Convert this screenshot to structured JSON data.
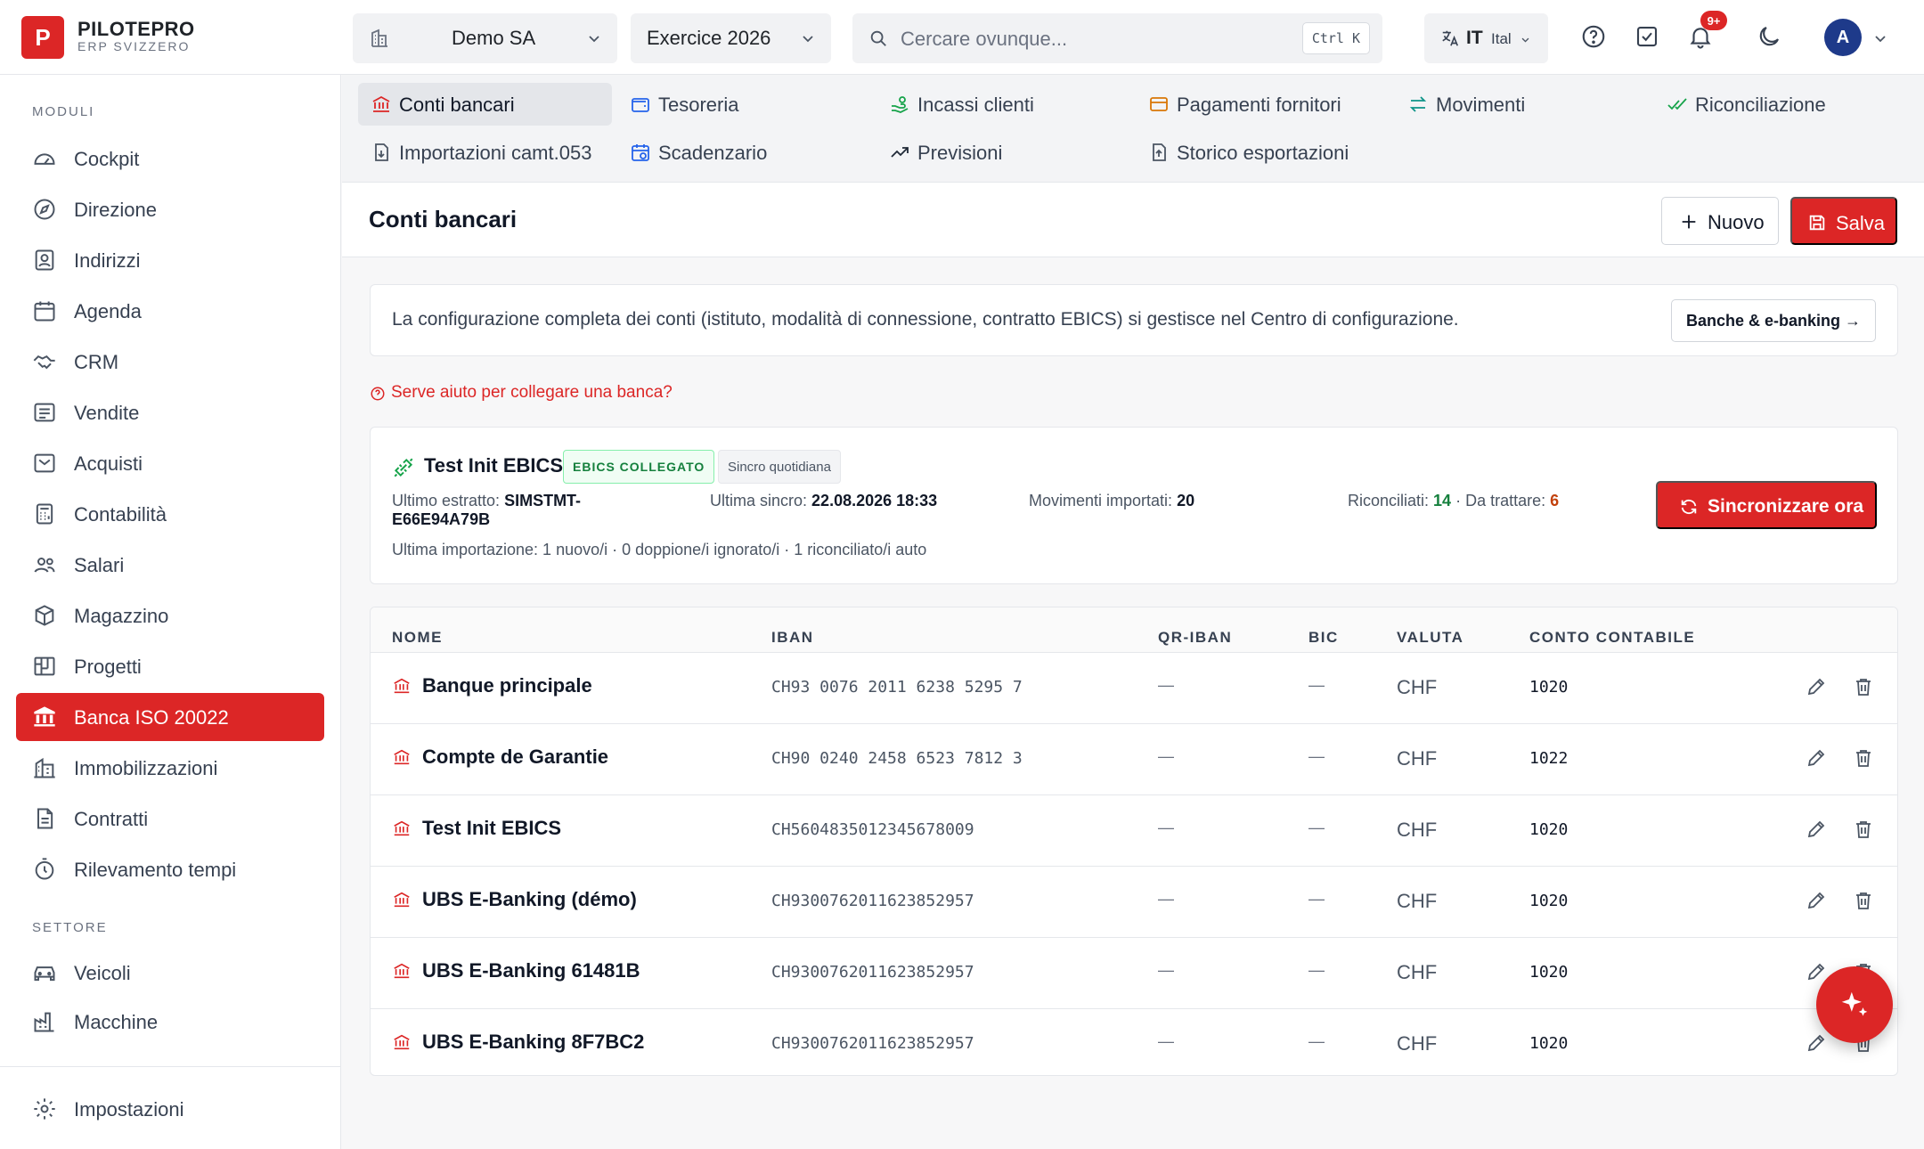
{
  "app": {
    "logo_letter": "P",
    "brand": "PILOTEPRO",
    "subtitle": "ERP SVIZZERO",
    "company": "Demo SA",
    "fiscal_year": "Exercice 2026",
    "search_placeholder": "Cercare ovunque...",
    "search_shortcut": "Ctrl K",
    "lang_code": "IT",
    "lang_name": "Ital",
    "notifications_badge": "9+",
    "avatar_letter": "A",
    "accent_color": "#dc2626"
  },
  "sidebar": {
    "section_modules": "MODULI",
    "modules": [
      {
        "label": "Cockpit",
        "icon": "gauge-icon"
      },
      {
        "label": "Direzione",
        "icon": "compass-icon"
      },
      {
        "label": "Indirizzi",
        "icon": "contact-card-icon"
      },
      {
        "label": "Agenda",
        "icon": "calendar-icon"
      },
      {
        "label": "CRM",
        "icon": "handshake-icon"
      },
      {
        "label": "Vendite",
        "icon": "receipt-icon"
      },
      {
        "label": "Acquisti",
        "icon": "inbox-icon"
      },
      {
        "label": "Contabilità",
        "icon": "calculator-icon"
      },
      {
        "label": "Salari",
        "icon": "users-icon"
      },
      {
        "label": "Magazzino",
        "icon": "package-icon"
      },
      {
        "label": "Progetti",
        "icon": "kanban-icon"
      },
      {
        "label": "Banca ISO 20022",
        "icon": "bank-icon",
        "active": true
      },
      {
        "label": "Immobilizzazioni",
        "icon": "building-icon"
      },
      {
        "label": "Contratti",
        "icon": "document-icon"
      },
      {
        "label": "Rilevamento tempi",
        "icon": "timer-icon"
      }
    ],
    "section_sector": "SETTORE",
    "sector": [
      {
        "label": "Veicoli",
        "icon": "car-icon"
      },
      {
        "label": "Macchine",
        "icon": "factory-icon"
      }
    ],
    "settings": "Impostazioni"
  },
  "subnav": {
    "tabs": [
      {
        "label": "Conti bancari",
        "icon": "bank-icon",
        "active": true
      },
      {
        "label": "Tesoreria",
        "icon": "wallet-icon"
      },
      {
        "label": "Incassi clienti",
        "icon": "hand-coins-icon"
      },
      {
        "label": "Pagamenti fornitori",
        "icon": "credit-card-icon"
      },
      {
        "label": "Movimenti",
        "icon": "arrows-swap-icon"
      },
      {
        "label": "Riconciliazione",
        "icon": "double-check-icon"
      },
      {
        "label": "Importazioni camt.053",
        "icon": "file-import-icon"
      },
      {
        "label": "Scadenzario",
        "icon": "calendar-clock-icon"
      },
      {
        "label": "Previsioni",
        "icon": "trending-up-icon"
      },
      {
        "label": "Storico esportazioni",
        "icon": "file-export-icon"
      }
    ]
  },
  "page": {
    "title": "Conti bancari",
    "new_label": "Nuovo",
    "save_label": "Salva"
  },
  "info": {
    "text": "La configurazione completa dei conti (istituto, modalità di connessione, contratto EBICS) si gestisce nel Centro di configurazione.",
    "button": "Banche & e-banking →"
  },
  "help_link": "Serve aiuto per collegare una banca?",
  "connection": {
    "name": "Test Init EBICS",
    "status_badge": "EBICS COLLEGATO",
    "sync_badge": "Sincro quotidiana",
    "last_statement_label": "Ultimo estratto:",
    "last_statement_value_1": "SIMSTMT-",
    "last_statement_value_2": "E66E94A79B",
    "last_sync_label": "Ultima sincro:",
    "last_sync_value": "22.08.2026 18:33",
    "imported_label": "Movimenti importati:",
    "imported_value": "20",
    "reconciled_label": "Riconciliati:",
    "reconciled_value": "14",
    "separator": "·",
    "to_process_label": "Da trattare:",
    "to_process_value": "6",
    "last_import": "Ultima importazione: 1 nuovo/i · 0 doppione/i ignorato/i · 1 riconciliato/i auto",
    "sync_button": "Sincronizzare ora"
  },
  "table": {
    "headers": {
      "name": "NOME",
      "iban": "IBAN",
      "qr_iban": "QR-IBAN",
      "bic": "BIC",
      "currency": "VALUTA",
      "account": "CONTO CONTABILE"
    },
    "rows": [
      {
        "name": "Banque principale",
        "iban": "CH93 0076 2011 6238 5295 7",
        "qr_iban": "—",
        "bic": "—",
        "currency": "CHF",
        "account": "1020"
      },
      {
        "name": "Compte de Garantie",
        "iban": "CH90 0240 2458 6523 7812 3",
        "qr_iban": "—",
        "bic": "—",
        "currency": "CHF",
        "account": "1022"
      },
      {
        "name": "Test Init EBICS",
        "iban": "CH5604835012345678009",
        "qr_iban": "—",
        "bic": "—",
        "currency": "CHF",
        "account": "1020"
      },
      {
        "name": "UBS E-Banking (démo)",
        "iban": "CH9300762011623852957",
        "qr_iban": "—",
        "bic": "—",
        "currency": "CHF",
        "account": "1020"
      },
      {
        "name": "UBS E-Banking 61481B",
        "iban": "CH9300762011623852957",
        "qr_iban": "—",
        "bic": "—",
        "currency": "CHF",
        "account": "1020"
      },
      {
        "name": "UBS E-Banking 8F7BC2",
        "iban": "CH9300762011623852957",
        "qr_iban": "—",
        "bic": "—",
        "currency": "CHF",
        "account": "1020"
      }
    ]
  }
}
